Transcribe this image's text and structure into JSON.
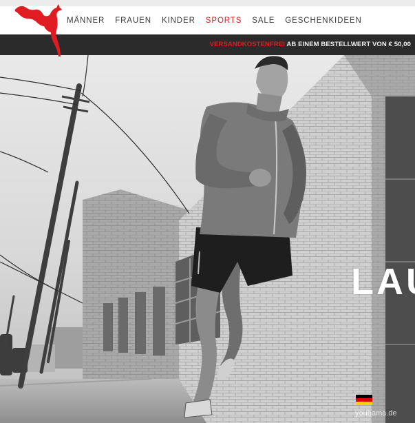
{
  "brand": {
    "name": "PUMA",
    "accent": "#e11b22"
  },
  "nav": {
    "items": [
      {
        "label": "MÄNNER",
        "active": false
      },
      {
        "label": "FRAUEN",
        "active": false
      },
      {
        "label": "KINDER",
        "active": false
      },
      {
        "label": "SPORTS",
        "active": true
      },
      {
        "label": "SALE",
        "active": false
      },
      {
        "label": "GESCHENKIDEEN",
        "active": false
      }
    ]
  },
  "promo": {
    "highlight": "VERSANDKOSTENFREI",
    "rest": " AB EINEM BESTELLWERT VON € 50,00"
  },
  "hero": {
    "headline": "LAU",
    "icon": "germany-flag-icon",
    "watermark": "youbama.de"
  }
}
